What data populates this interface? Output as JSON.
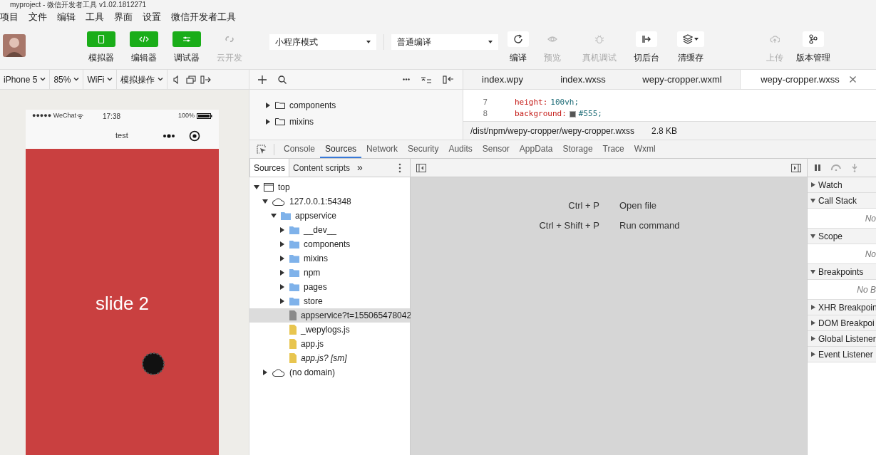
{
  "window": {
    "title": "myproject - 微信开发者工具 v1.02.1812271"
  },
  "menu": [
    "项目",
    "文件",
    "编辑",
    "工具",
    "界面",
    "设置",
    "微信开发者工具"
  ],
  "toolbar": {
    "views": [
      {
        "label": "模拟器",
        "on": true
      },
      {
        "label": "编辑器",
        "on": true
      },
      {
        "label": "调试器",
        "on": true
      },
      {
        "label": "云开发",
        "on": false
      }
    ],
    "mode_select": {
      "value": "小程序模式"
    },
    "compile_select": {
      "value": "普通编译"
    },
    "actions": [
      {
        "label": "编译",
        "disabled": false
      },
      {
        "label": "预览",
        "disabled": true
      },
      {
        "label": "真机调试",
        "disabled": true
      },
      {
        "label": "切后台",
        "disabled": false
      },
      {
        "label": "清缓存",
        "disabled": false
      },
      {
        "label": "上传",
        "disabled": true
      },
      {
        "label": "版本管理",
        "disabled": false
      }
    ]
  },
  "simulator": {
    "controls": [
      "iPhone 5",
      "85%",
      "WiFi",
      "模拟操作"
    ],
    "phone": {
      "carrier": "●●●●● WeChat",
      "time": "17:38",
      "battery": "100%",
      "page_title": "test",
      "slide_text": "slide 2"
    }
  },
  "file_tree": [
    {
      "name": "components"
    },
    {
      "name": "mixins"
    }
  ],
  "editor": {
    "tabs": [
      {
        "label": "index.wpy",
        "selected": false
      },
      {
        "label": "index.wxss",
        "selected": false
      },
      {
        "label": "wepy-cropper.wxml",
        "selected": false
      },
      {
        "label": "wepy-cropper.wxss",
        "selected": true
      }
    ],
    "lines": [
      {
        "number": "7",
        "property": "height:",
        "value": "100vh;",
        "kind": "plain"
      },
      {
        "number": "8",
        "property": "background:",
        "value": "#555;",
        "kind": "color"
      }
    ],
    "path": "/dist/npm/wepy-cropper/wepy-cropper.wxss",
    "size": "2.8 KB"
  },
  "devtools": {
    "tabs": [
      {
        "label": "Console",
        "selected": false
      },
      {
        "label": "Sources",
        "selected": true
      },
      {
        "label": "Network",
        "selected": false
      },
      {
        "label": "Security",
        "selected": false
      },
      {
        "label": "Audits",
        "selected": false
      },
      {
        "label": "Sensor",
        "selected": false
      },
      {
        "label": "AppData",
        "selected": false
      },
      {
        "label": "Storage",
        "selected": false
      },
      {
        "label": "Trace",
        "selected": false
      },
      {
        "label": "Wxml",
        "selected": false
      }
    ],
    "navigator_tabs": [
      {
        "label": "Sources",
        "selected": true
      },
      {
        "label": "Content scripts",
        "selected": false
      }
    ],
    "more": "»",
    "tree": [
      {
        "name": "top",
        "kind": "frame",
        "expanded": true,
        "children": [
          {
            "name": "127.0.0.1:54348",
            "kind": "cloud",
            "expanded": true,
            "children": [
              {
                "name": "appservice",
                "kind": "folder",
                "expanded": true,
                "children": [
                  {
                    "name": "__dev__",
                    "kind": "folder",
                    "expanded": false
                  },
                  {
                    "name": "components",
                    "kind": "folder",
                    "expanded": false
                  },
                  {
                    "name": "mixins",
                    "kind": "folder",
                    "expanded": false
                  },
                  {
                    "name": "npm",
                    "kind": "folder",
                    "expanded": false
                  },
                  {
                    "name": "pages",
                    "kind": "folder",
                    "expanded": false
                  },
                  {
                    "name": "store",
                    "kind": "folder",
                    "expanded": false
                  },
                  {
                    "name": "appservice?t=155065478042",
                    "kind": "file",
                    "selected": true
                  },
                  {
                    "name": "_wepylogs.js",
                    "kind": "script"
                  },
                  {
                    "name": "app.js",
                    "kind": "script"
                  },
                  {
                    "name": "app.js? [sm]",
                    "kind": "script",
                    "italic": true
                  }
                ]
              }
            ]
          },
          {
            "name": "(no domain)",
            "kind": "cloud",
            "expanded": false
          }
        ]
      }
    ],
    "shortcuts": [
      {
        "keys": "Ctrl + P",
        "action": "Open file"
      },
      {
        "keys": "Ctrl + Shift + P",
        "action": "Run command"
      }
    ],
    "debugger": [
      {
        "title": "Watch",
        "expanded": false
      },
      {
        "title": "Call Stack",
        "expanded": true,
        "body": "No"
      },
      {
        "title": "Scope",
        "expanded": true,
        "body": "No"
      },
      {
        "title": "Breakpoints",
        "expanded": true,
        "body": "No B"
      },
      {
        "title": "XHR Breakpoin",
        "expanded": false
      },
      {
        "title": "DOM Breakpoi",
        "expanded": false
      },
      {
        "title": "Global Listener",
        "expanded": false
      },
      {
        "title": "Event Listener",
        "expanded": false
      }
    ]
  }
}
